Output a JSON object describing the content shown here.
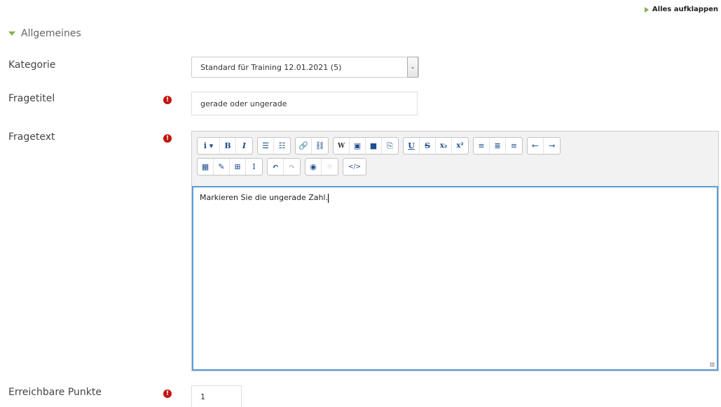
{
  "header": {
    "expand_all_label": "Alles aufklappen"
  },
  "section": {
    "title": "Allgemeines"
  },
  "fields": {
    "category": {
      "label": "Kategorie",
      "value": "Standard für Training 12.01.2021 (5)"
    },
    "title": {
      "label": "Fragetitel",
      "value": "gerade oder ungerade",
      "required_icon": "!"
    },
    "text": {
      "label": "Fragetext",
      "value": "Markieren Sie die ungerade Zahl.",
      "required_icon": "!"
    },
    "points": {
      "label": "Erreichbare Punkte",
      "value": "1",
      "required_icon": "!"
    }
  },
  "toolbar": {
    "row1": [
      [
        "i ▾",
        "B",
        "I"
      ],
      [
        "☰",
        "☷"
      ],
      [
        "🔗",
        "⛓"
      ],
      [
        "W",
        "▣",
        "■",
        "⎘"
      ],
      [
        "U",
        "S",
        "x₂",
        "x²"
      ],
      [
        "≡",
        "≣",
        "≡"
      ],
      [
        "⇤",
        "⇥"
      ]
    ],
    "row2": [
      [
        "▦",
        "✎",
        "⊞",
        "Ⅰ"
      ],
      [
        "↶",
        "↷"
      ],
      [
        "◉",
        "⁘"
      ],
      [
        "</>"
      ]
    ]
  },
  "colors": {
    "accent_green": "#7fb04f",
    "required_red": "#c4140f",
    "focus_blue": "#5b9dd9",
    "icon_blue": "#1f4f8f"
  }
}
